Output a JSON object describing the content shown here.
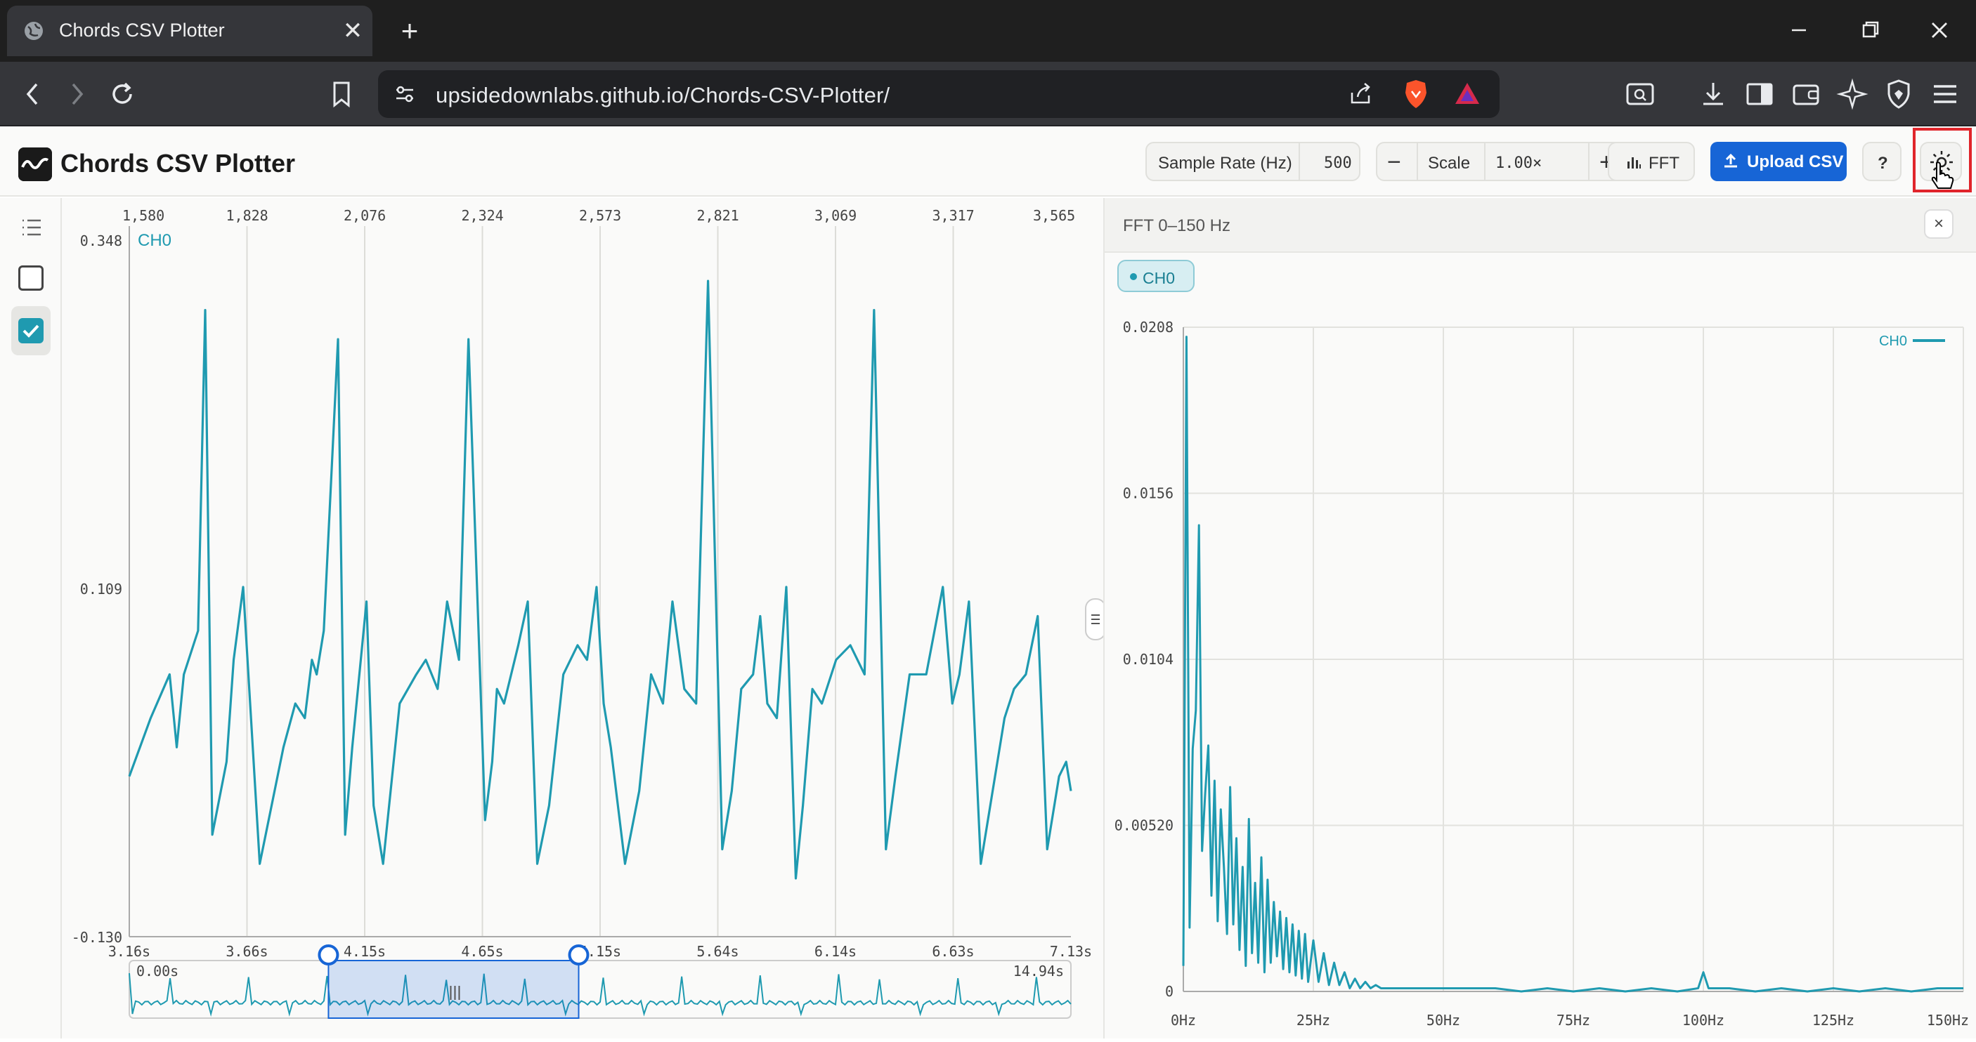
{
  "browser": {
    "tab_title": "Chords CSV Plotter",
    "tab_close": "✕",
    "new_tab": "+",
    "url": "upsidedownlabs.github.io/Chords-CSV-Plotter/"
  },
  "app": {
    "title": "Chords CSV Plotter",
    "sample_rate_label": "Sample Rate (Hz)",
    "sample_rate_value": "500",
    "minus": "−",
    "scale_label": "Scale",
    "scale_value": "1.00×",
    "plus": "+",
    "fft_label": "FFT",
    "upload_label": "Upload CSV",
    "help": "?"
  },
  "rail": {
    "list_icon": "list-icon",
    "checkbox_off": "checkbox-empty-icon",
    "checkbox_on": "checkbox-checked-icon"
  },
  "colors": {
    "signal": "#1f9ab0",
    "accent": "#1765d6",
    "highlight": "#e0252b"
  },
  "chart_data": [
    {
      "type": "line",
      "channel_label": "CH0",
      "top_ticks": [
        "1,580",
        "1,828",
        "2,076",
        "2,324",
        "2,573",
        "2,821",
        "3,069",
        "3,317",
        "3,565"
      ],
      "y_ticks": [
        "0.348",
        "0.109",
        "-0.130"
      ],
      "x_ticks": [
        "3.16s",
        "3.66s",
        "4.15s",
        "4.65s",
        "5.15s",
        "5.64s",
        "6.14s",
        "6.63s",
        "7.13s"
      ],
      "xlim": [
        3.16,
        7.13
      ],
      "ylim": [
        -0.13,
        0.348
      ],
      "series": [
        {
          "name": "CH0",
          "x": [
            3.16,
            3.25,
            3.33,
            3.36,
            3.39,
            3.45,
            3.48,
            3.51,
            3.57,
            3.6,
            3.64,
            3.71,
            3.81,
            3.86,
            3.9,
            3.93,
            3.95,
            3.98,
            4.04,
            4.07,
            4.1,
            4.16,
            4.19,
            4.23,
            4.3,
            4.37,
            4.41,
            4.46,
            4.5,
            4.55,
            4.59,
            4.66,
            4.69,
            4.71,
            4.74,
            4.8,
            4.84,
            4.88,
            4.93,
            4.99,
            5.05,
            5.09,
            5.13,
            5.16,
            5.19,
            5.25,
            5.31,
            5.36,
            5.41,
            5.45,
            5.5,
            5.55,
            5.6,
            5.66,
            5.7,
            5.74,
            5.79,
            5.82,
            5.85,
            5.89,
            5.93,
            5.97,
            6.0,
            6.04,
            6.08,
            6.14,
            6.2,
            6.26,
            6.3,
            6.35,
            6.39,
            6.45,
            6.52,
            6.59,
            6.63,
            6.66,
            6.7,
            6.75,
            6.81,
            6.85,
            6.89,
            6.94,
            6.99,
            7.03,
            7.08,
            7.11,
            7.13
          ],
          "values": [
            -0.02,
            0.02,
            0.05,
            0.0,
            0.05,
            0.08,
            0.3,
            -0.06,
            -0.01,
            0.06,
            0.11,
            -0.08,
            0.0,
            0.03,
            0.02,
            0.06,
            0.05,
            0.08,
            0.28,
            -0.06,
            0.0,
            0.1,
            -0.04,
            -0.08,
            0.03,
            0.05,
            0.06,
            0.04,
            0.1,
            0.06,
            0.28,
            -0.05,
            -0.01,
            0.04,
            0.03,
            0.07,
            0.1,
            -0.08,
            -0.04,
            0.05,
            0.07,
            0.06,
            0.11,
            0.03,
            0.0,
            -0.08,
            -0.03,
            0.05,
            0.03,
            0.1,
            0.04,
            0.03,
            0.32,
            -0.07,
            -0.03,
            0.04,
            0.05,
            0.09,
            0.03,
            0.02,
            0.11,
            -0.09,
            -0.04,
            0.04,
            0.03,
            0.06,
            0.07,
            0.05,
            0.3,
            -0.07,
            -0.02,
            0.05,
            0.05,
            0.11,
            0.03,
            0.05,
            0.1,
            -0.08,
            -0.02,
            0.02,
            0.04,
            0.05,
            0.09,
            -0.07,
            -0.02,
            -0.01,
            -0.03
          ]
        }
      ],
      "navigator": {
        "start_label": "0.00s",
        "end_label": "14.94s",
        "range": [
          3.16,
          7.13
        ]
      }
    },
    {
      "type": "line",
      "title": "FFT 0–150 Hz",
      "chip_label": "CH0",
      "legend_label": "CH0",
      "y_ticks": [
        "0.0208",
        "0.0156",
        "0.0104",
        "0.00520",
        "0"
      ],
      "x_ticks": [
        "0Hz",
        "25Hz",
        "50Hz",
        "75Hz",
        "100Hz",
        "125Hz",
        "150Hz"
      ],
      "xlim": [
        0,
        150
      ],
      "ylim": [
        0,
        0.0208
      ],
      "series": [
        {
          "name": "CH0",
          "x": [
            0,
            0.6,
            1.2,
            1.8,
            2.4,
            3.0,
            3.6,
            4.2,
            4.8,
            5.4,
            6.0,
            6.6,
            7.2,
            7.8,
            8.4,
            9.0,
            9.6,
            10.2,
            10.8,
            11.4,
            12.0,
            12.6,
            13.2,
            13.8,
            14.4,
            15.0,
            15.6,
            16.2,
            16.8,
            17.4,
            18.0,
            18.6,
            19.2,
            19.8,
            20.4,
            21.0,
            21.6,
            22.2,
            22.8,
            23.4,
            24.0,
            25.0,
            26.0,
            27.0,
            28.0,
            29.0,
            30.0,
            31.0,
            32.0,
            33.0,
            34.0,
            35.0,
            36.0,
            37.0,
            38.0,
            40.0,
            45.0,
            50.0,
            55.0,
            60.0,
            65.0,
            70.0,
            75.0,
            80.0,
            85.0,
            90.0,
            95.0,
            99.0,
            100.0,
            101.0,
            105.0,
            110.0,
            115.0,
            120.0,
            125.0,
            130.0,
            135.0,
            140.0,
            145.0,
            150.0
          ],
          "values": [
            0.0008,
            0.0205,
            0.002,
            0.0076,
            0.0088,
            0.0146,
            0.0044,
            0.0062,
            0.0077,
            0.003,
            0.0066,
            0.0022,
            0.0057,
            0.0039,
            0.0018,
            0.0064,
            0.0021,
            0.0048,
            0.0013,
            0.0039,
            0.0008,
            0.0054,
            0.0012,
            0.0034,
            0.0009,
            0.0042,
            0.0006,
            0.0035,
            0.0009,
            0.0028,
            0.0011,
            0.0025,
            0.0007,
            0.0023,
            0.0006,
            0.0021,
            0.0005,
            0.0019,
            0.0004,
            0.0018,
            0.0003,
            0.0016,
            0.0003,
            0.0012,
            0.0002,
            0.0009,
            0.0002,
            0.0006,
            0.0001,
            0.0004,
            0.0001,
            0.0003,
            0.0001,
            0.0002,
            0.0001,
            0.0001,
            0.0001,
            0.0001,
            0.0001,
            0.0001,
            0.0,
            0.0001,
            0.0,
            0.0001,
            0.0,
            0.0001,
            0.0,
            0.0001,
            0.0006,
            0.0001,
            0.0001,
            0.0,
            0.0001,
            0.0,
            0.0001,
            0.0,
            0.0001,
            0.0,
            0.0001,
            0.0001
          ]
        }
      ]
    }
  ]
}
